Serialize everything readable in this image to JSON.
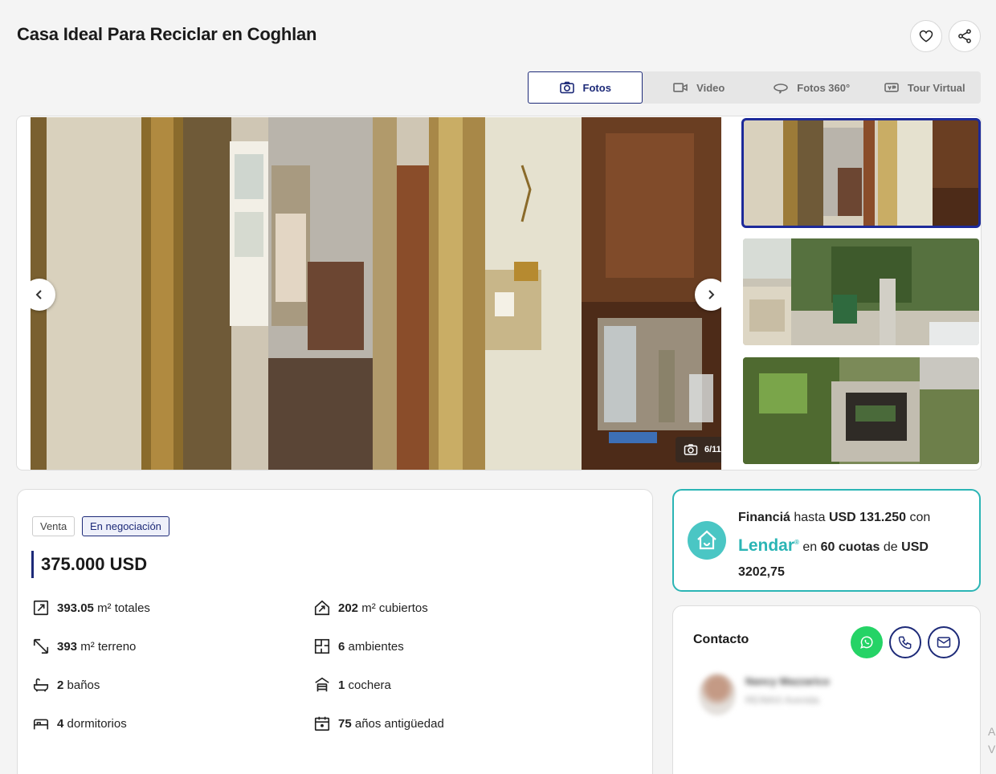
{
  "listing": {
    "title": "Casa Ideal Para Reciclar en Coghlan"
  },
  "actions": {
    "favorite_icon": "heart-icon",
    "share_icon": "share-icon"
  },
  "media_tabs": [
    {
      "label": "Fotos",
      "icon": "camera-icon",
      "active": true
    },
    {
      "label": "Video",
      "icon": "video-icon",
      "active": false
    },
    {
      "label": "Fotos 360°",
      "icon": "360-icon",
      "active": false
    },
    {
      "label": "Tour Virtual",
      "icon": "vr-icon",
      "active": false
    }
  ],
  "gallery": {
    "counter": "6/11",
    "thumbnails": 3
  },
  "badges": {
    "operation": "Venta",
    "status": "En negociación"
  },
  "price": "375.000 USD",
  "features": [
    {
      "value": "393.05",
      "label": "m² totales",
      "icon": "total-area-icon"
    },
    {
      "value": "202",
      "label": "m² cubiertos",
      "icon": "covered-area-icon"
    },
    {
      "value": "393",
      "label": "m² terreno",
      "icon": "land-icon"
    },
    {
      "value": "6",
      "label": "ambientes",
      "icon": "rooms-icon"
    },
    {
      "value": "2",
      "label": "baños",
      "icon": "bathtub-icon"
    },
    {
      "value": "1",
      "label": "cochera",
      "icon": "garage-icon"
    },
    {
      "value": "4",
      "label": "dormitorios",
      "icon": "bed-icon"
    },
    {
      "value": "75",
      "label": "años antigüedad",
      "icon": "calendar-icon"
    }
  ],
  "financing": {
    "lead": "Financiá",
    "hasta": "hasta",
    "amount": "USD 131.250",
    "con": "con",
    "brand": "Lendar",
    "brand_mark": "®",
    "en": "en",
    "installments": "60 cuotas",
    "de": "de",
    "currency": "USD",
    "installment_value": "3202,75",
    "accent": "#2bb5b5"
  },
  "contact": {
    "title": "Contacto",
    "agent_name": "Nancy Mazzarico",
    "agent_agency": "RE/MAX Avenida",
    "whatsapp_color": "#25d366",
    "accent": "#1d2a78"
  },
  "edge_text": {
    "line1": "A",
    "line2": "V"
  }
}
